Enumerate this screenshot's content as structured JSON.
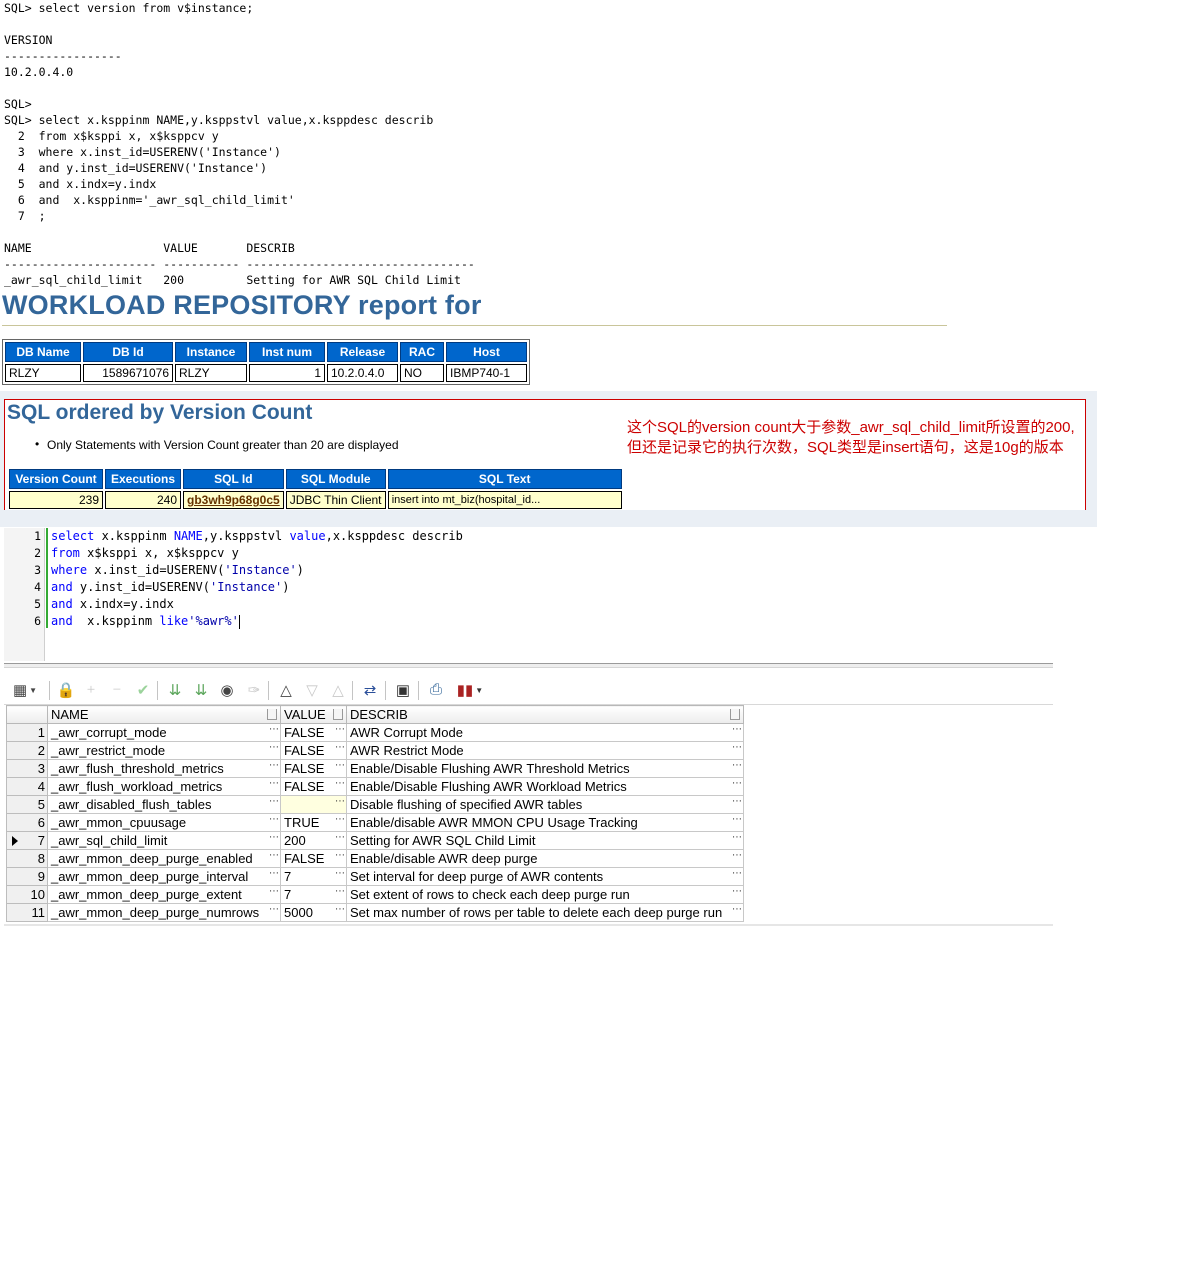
{
  "console": {
    "lines": [
      "SQL> select version from v$instance;",
      "",
      "VERSION",
      "-----------------",
      "10.2.0.4.0",
      "",
      "SQL>",
      "SQL> select x.ksppinm NAME,y.ksppstvl value,x.ksppdesc describ",
      "  2  from x$ksppi x, x$ksppcv y",
      "  3  where x.inst_id=USERENV('Instance')",
      "  4  and y.inst_id=USERENV('Instance')",
      "  5  and x.indx=y.indx",
      "  6  and  x.ksppinm='_awr_sql_child_limit'",
      "  7  ;",
      "",
      "NAME                   VALUE       DESCRIB",
      "---------------------- ----------- ---------------------------------",
      "_awr_sql_child_limit   200         Setting for AWR SQL Child Limit"
    ]
  },
  "awr": {
    "title": "WORKLOAD REPOSITORY report for",
    "db_table": {
      "headers": [
        "DB Name",
        "DB Id",
        "Instance",
        "Inst num",
        "Release",
        "RAC",
        "Host"
      ],
      "row": [
        "RLZY",
        "1589671076",
        "RLZY",
        "1",
        "10.2.0.4.0",
        "NO",
        "IBMP740-1"
      ]
    }
  },
  "version_count": {
    "title": "SQL ordered by Version Count",
    "bullet": "Only Statements with Version Count greater than 20 are displayed",
    "headers": [
      "Version Count",
      "Executions",
      "SQL Id",
      "SQL Module",
      "SQL Text"
    ],
    "row": [
      "239",
      "240",
      "gb3wh9p68g0c5",
      "JDBC Thin Client",
      "insert into mt_biz(hospital_id..."
    ],
    "note": "这个SQL的version count大于参数_awr_sql_child_limit所设置的200,但还是记录它的执行次数，SQL类型是insert语句，这是10g的版本"
  },
  "editor": {
    "line_numbers": [
      "1",
      "2",
      "3",
      "4",
      "5",
      "6"
    ],
    "lines": [
      [
        [
          "kw",
          "select "
        ],
        [
          "id",
          "x.ksppinm "
        ],
        [
          "kw",
          "NAME"
        ],
        [
          "punc",
          ","
        ],
        [
          "id",
          "y.ksppstvl "
        ],
        [
          "kw",
          "value"
        ],
        [
          "punc",
          ","
        ],
        [
          "id",
          "x.ksppdesc describ"
        ]
      ],
      [
        [
          "kw",
          "from "
        ],
        [
          "id",
          "x$ksppi x, x$ksppcv y"
        ]
      ],
      [
        [
          "kw",
          "where "
        ],
        [
          "id",
          "x.inst_id="
        ],
        [
          "fn",
          "USERENV"
        ],
        [
          "punc",
          "("
        ],
        [
          "str",
          "'Instance'"
        ],
        [
          "punc",
          ")"
        ]
      ],
      [
        [
          "kw",
          "and "
        ],
        [
          "id",
          "y.inst_id="
        ],
        [
          "fn",
          "USERENV"
        ],
        [
          "punc",
          "("
        ],
        [
          "str",
          "'Instance'"
        ],
        [
          "punc",
          ")"
        ]
      ],
      [
        [
          "kw",
          "and "
        ],
        [
          "id",
          "x.indx=y.indx"
        ]
      ],
      [
        [
          "kw",
          "and  "
        ],
        [
          "id",
          "x.ksppinm "
        ],
        [
          "kw",
          "like"
        ],
        [
          "str",
          "'%awr%'"
        ]
      ]
    ]
  },
  "toolbar": {
    "icons": [
      "grid-menu-icon",
      "lock-icon",
      "add-record-icon",
      "delete-record-icon",
      "post-changes-icon",
      "fetch-next-icon",
      "fetch-all-icon",
      "find-icon",
      "clear-icon",
      "query-by-example-icon",
      "filter-down-icon",
      "filter-up-icon",
      "export-icon",
      "save-icon",
      "print-icon",
      "chart-icon"
    ]
  },
  "grid": {
    "columns": [
      "NAME",
      "VALUE",
      "DESCRIB"
    ],
    "current_row": 7,
    "rows": [
      {
        "num": "1",
        "name": "_awr_corrupt_mode",
        "value": "FALSE",
        "describ": "AWR Corrupt Mode"
      },
      {
        "num": "2",
        "name": "_awr_restrict_mode",
        "value": "FALSE",
        "describ": "AWR Restrict Mode"
      },
      {
        "num": "3",
        "name": "_awr_flush_threshold_metrics",
        "value": "FALSE",
        "describ": "Enable/Disable Flushing AWR Threshold Metrics"
      },
      {
        "num": "4",
        "name": "_awr_flush_workload_metrics",
        "value": "FALSE",
        "describ": "Enable/Disable Flushing AWR Workload Metrics"
      },
      {
        "num": "5",
        "name": "_awr_disabled_flush_tables",
        "value": "",
        "describ": "Disable flushing of specified AWR tables"
      },
      {
        "num": "6",
        "name": "_awr_mmon_cpuusage",
        "value": "TRUE",
        "describ": "Enable/disable AWR MMON CPU Usage Tracking"
      },
      {
        "num": "7",
        "name": "_awr_sql_child_limit",
        "value": "200",
        "describ": "Setting for AWR SQL Child Limit"
      },
      {
        "num": "8",
        "name": "_awr_mmon_deep_purge_enabled",
        "value": "FALSE",
        "describ": "Enable/disable AWR deep purge"
      },
      {
        "num": "9",
        "name": "_awr_mmon_deep_purge_interval",
        "value": "7",
        "describ": "Set interval for deep purge of AWR contents"
      },
      {
        "num": "10",
        "name": "_awr_mmon_deep_purge_extent",
        "value": "7",
        "describ": "Set extent of rows to check each deep purge run"
      },
      {
        "num": "11",
        "name": "_awr_mmon_deep_purge_numrows",
        "value": "5000",
        "describ": "Set max number of rows per table to delete each deep purge run"
      }
    ]
  },
  "colors": {
    "awr_title": "#336699",
    "awr_header_bg": "#0066cc",
    "cell_highlight": "#ffffcc",
    "note_red": "#cc0000",
    "sql_keyword": "#0000ff"
  }
}
